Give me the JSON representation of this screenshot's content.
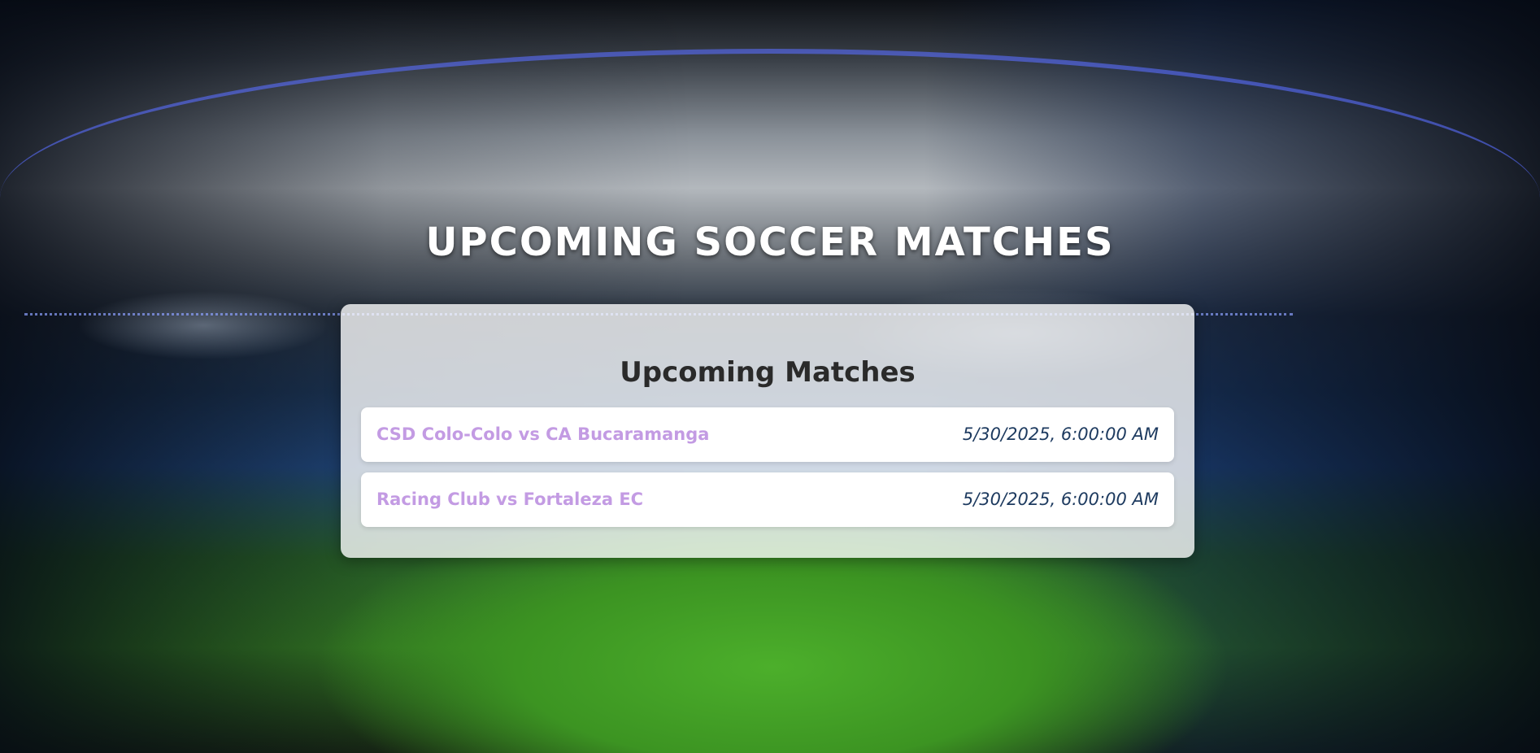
{
  "page": {
    "title": "UPCOMING SOCCER MATCHES"
  },
  "panel": {
    "title": "Upcoming Matches",
    "matches": [
      {
        "teams": "CSD Colo-Colo vs CA Bucaramanga",
        "datetime": "5/30/2025, 6:00:00 AM"
      },
      {
        "teams": "Racing Club vs Fortaleza EC",
        "datetime": "5/30/2025, 6:00:00 AM"
      }
    ]
  },
  "colors": {
    "team_text": "#c39be3",
    "time_text": "#1d3a5f",
    "title_text": "#ffffff",
    "panel_title": "#2a2a2a"
  }
}
